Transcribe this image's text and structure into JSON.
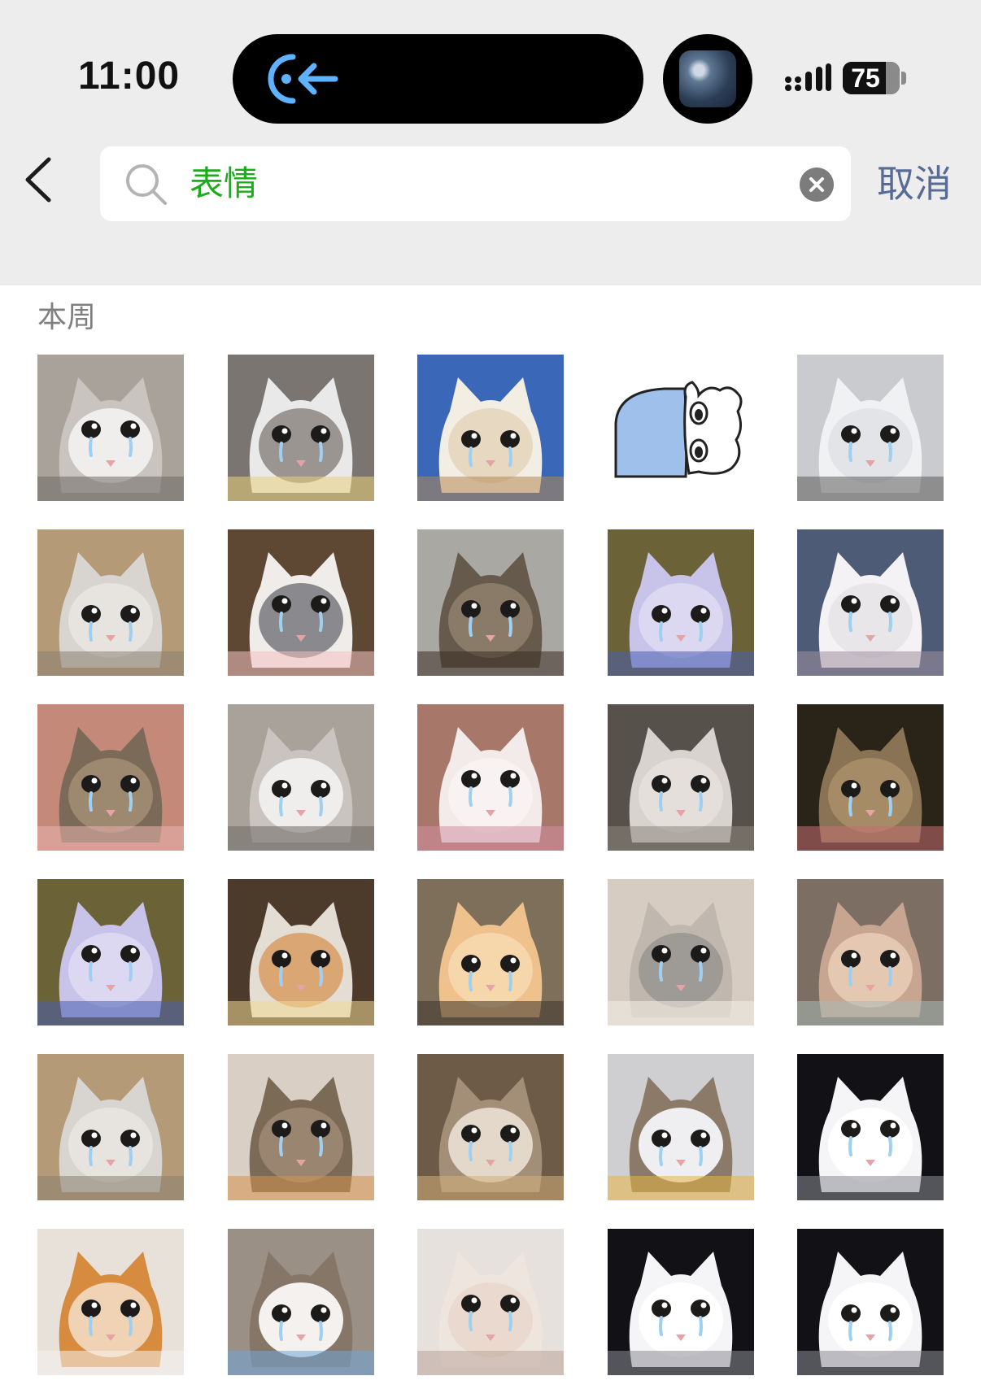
{
  "status_bar": {
    "time": "11:00",
    "battery_level": "75",
    "battery_percent": 75
  },
  "search": {
    "query": "表情",
    "cancel_label": "取消"
  },
  "section": {
    "title": "本周"
  },
  "colors": {
    "header_bg": "#ededed",
    "query_text": "#1aad19",
    "cancel_text": "#576b95",
    "section_text": "#808080"
  },
  "stickers": [
    {
      "bg": "#a9a29a",
      "fur": "#c9c4bf",
      "face": "#efeeed",
      "accent": "#6f6a66"
    },
    {
      "bg": "#7a7570",
      "fur": "#e9e9ea",
      "face": "#9a9590",
      "accent": "#e8cf7a"
    },
    {
      "bg": "#3b67b8",
      "fur": "#f3eee4",
      "face": "#e6d8c1",
      "accent": "#b28954"
    },
    {
      "bg": "#ffffff",
      "fur": "#ffffff",
      "face": "#ffffff",
      "accent": "#9fc0ea",
      "drawing": true
    },
    {
      "bg": "#c9cbcf",
      "fur": "#f0f1f3",
      "face": "#e3e4e7",
      "accent": "#5c5c5a"
    },
    {
      "bg": "#b59a78",
      "fur": "#d8d5d1",
      "face": "#e7e4e0",
      "accent": "#8a8070"
    },
    {
      "bg": "#5e4733",
      "fur": "#efece9",
      "face": "#8a8a8e",
      "accent": "#f3c1c1"
    },
    {
      "bg": "#aaa8a2",
      "fur": "#665a4d",
      "face": "#8a7b68",
      "accent": "#3a2e25"
    },
    {
      "bg": "#6b6337",
      "fur": "#c8c3e8",
      "face": "#dcd8f2",
      "accent": "#4a5fb0"
    },
    {
      "bg": "#4d5b76",
      "fur": "#f4f2f4",
      "face": "#e9e6ea",
      "accent": "#9f8fa0"
    },
    {
      "bg": "#c5897a",
      "fur": "#7b6a58",
      "face": "#9d8870",
      "accent": "#e7b3ae"
    },
    {
      "bg": "#a9a29a",
      "fur": "#c9c4bf",
      "face": "#efeeed",
      "accent": "#6f6a66"
    },
    {
      "bg": "#a77769",
      "fur": "#f2ebea",
      "face": "#f8f2f2",
      "accent": "#d48fa0"
    },
    {
      "bg": "#56514a",
      "fur": "#d8d3cf",
      "face": "#e4dfdb",
      "accent": "#8e8680"
    },
    {
      "bg": "#2a2318",
      "fur": "#8a7354",
      "face": "#a58b66",
      "accent": "#c56f73"
    },
    {
      "bg": "#6b6337",
      "fur": "#c8c3e8",
      "face": "#dcd8f2",
      "accent": "#4a5fb0"
    },
    {
      "bg": "#4c3a2b",
      "fur": "#e4ddd3",
      "face": "#d9a674",
      "accent": "#f1d995"
    },
    {
      "bg": "#7e6f5b",
      "fur": "#efc18c",
      "face": "#f6d6ab",
      "accent": "#3c342a"
    },
    {
      "bg": "#d6ccc2",
      "fur": "#c0b8ae",
      "face": "#9e9a96",
      "accent": "#f4efe6"
    },
    {
      "bg": "#7d6e63",
      "fur": "#c7a590",
      "face": "#e4c8b2",
      "accent": "#a8b9b6"
    },
    {
      "bg": "#b59a78",
      "fur": "#d8d5d1",
      "face": "#e7e4e0",
      "accent": "#8a8070"
    },
    {
      "bg": "#d9cfc4",
      "fur": "#7a6a56",
      "face": "#9a8670",
      "accent": "#d59450"
    },
    {
      "bg": "#6d5a47",
      "fur": "#a38e77",
      "face": "#e4d8cb",
      "accent": "#d4b07a"
    },
    {
      "bg": "#cfcfd2",
      "fur": "#8b7a68",
      "face": "#efeff1",
      "accent": "#e7b544"
    },
    {
      "bg": "#121216",
      "fur": "#f5f5f7",
      "face": "#ffffff",
      "accent": "#8a8a95"
    },
    {
      "bg": "#e7e1da",
      "fur": "#d78b3f",
      "face": "#f0d2b4",
      "accent": "#f5f2ee"
    },
    {
      "bg": "#9b9085",
      "fur": "#857667",
      "face": "#f4f1ee",
      "accent": "#6fa6d8"
    },
    {
      "bg": "#e6e1dc",
      "fur": "#efe5df",
      "face": "#e9d9cf",
      "accent": "#b9a59b"
    },
    {
      "bg": "#121216",
      "fur": "#f5f5f7",
      "face": "#ffffff",
      "accent": "#8a8a95"
    },
    {
      "bg": "#121216",
      "fur": "#f5f5f7",
      "face": "#ffffff",
      "accent": "#8a8a95"
    }
  ]
}
